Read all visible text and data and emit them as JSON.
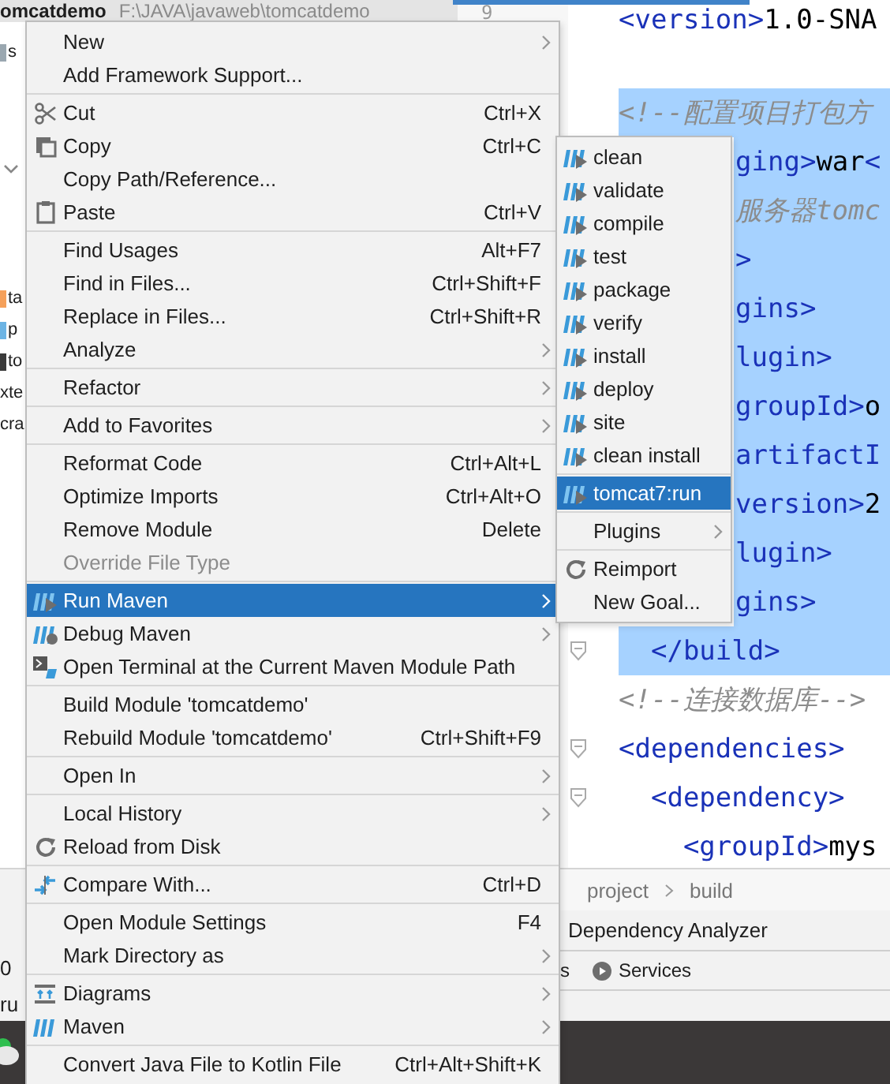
{
  "project_header": {
    "name": "omcatdemo",
    "path": "F:\\JAVA\\javaweb\\tomcatdemo"
  },
  "project_tree": [
    {
      "text": "s",
      "color": "#9aa7b0"
    },
    {
      "text": "ta",
      "color": "#f5a05a"
    },
    {
      "text": "p",
      "color": "#6cb4e4"
    },
    {
      "text": "to",
      "color": "#3a3a3a"
    },
    {
      "text": "xte"
    },
    {
      "text": "cra"
    }
  ],
  "editor": {
    "line_number": "9",
    "lines": [
      {
        "kind": "full",
        "selected": false,
        "parts": [
          {
            "kind": "tag",
            "t": "<version>"
          },
          {
            "kind": "text",
            "t": "1.0-SNA"
          }
        ]
      },
      {
        "kind": "blank"
      },
      {
        "kind": "full",
        "selected": true,
        "parts": [
          {
            "kind": "comment",
            "t": "<!--配置项目打包方"
          }
        ]
      },
      {
        "kind": "partial",
        "selected": true,
        "parts": [
          {
            "kind": "tag",
            "t": "ging>"
          },
          {
            "kind": "text",
            "t": "war"
          },
          {
            "kind": "tag",
            "t": "<"
          }
        ]
      },
      {
        "kind": "partial",
        "selected": true,
        "parts": [
          {
            "kind": "comment",
            "t": "服务器tomc"
          }
        ]
      },
      {
        "kind": "partial",
        "selected": true,
        "parts": [
          {
            "kind": "tag",
            "t": ">"
          }
        ]
      },
      {
        "kind": "partial",
        "selected": true,
        "parts": [
          {
            "kind": "tag",
            "t": "gins>"
          }
        ]
      },
      {
        "kind": "partial",
        "selected": true,
        "parts": [
          {
            "kind": "tag",
            "t": "lugin>"
          }
        ]
      },
      {
        "kind": "partial",
        "selected": true,
        "parts": [
          {
            "kind": "tag",
            "t": "groupId>"
          },
          {
            "kind": "text",
            "t": "o"
          }
        ]
      },
      {
        "kind": "partial",
        "selected": true,
        "parts": [
          {
            "kind": "tag",
            "t": "artifactI"
          }
        ]
      },
      {
        "kind": "partial",
        "selected": true,
        "parts": [
          {
            "kind": "tag",
            "t": "version>"
          },
          {
            "kind": "text",
            "t": "2"
          }
        ]
      },
      {
        "kind": "partial",
        "selected": true,
        "parts": [
          {
            "kind": "tag",
            "t": "lugin>"
          }
        ]
      },
      {
        "kind": "partial",
        "selected": true,
        "parts": [
          {
            "kind": "tag",
            "t": "gins>"
          }
        ]
      },
      {
        "kind": "full",
        "selected": true,
        "fold": true,
        "parts": [
          {
            "kind": "tag",
            "t": "  </build>"
          }
        ]
      },
      {
        "kind": "full",
        "selected": false,
        "parts": [
          {
            "kind": "comment",
            "t": "<!--连接数据库-->"
          }
        ]
      },
      {
        "kind": "full",
        "selected": false,
        "fold": true,
        "parts": [
          {
            "kind": "tag",
            "t": "<dependencies>"
          }
        ]
      },
      {
        "kind": "full",
        "selected": false,
        "fold": true,
        "parts": [
          {
            "kind": "tag",
            "t": "  <dependency>"
          }
        ]
      },
      {
        "kind": "full",
        "selected": false,
        "parts": [
          {
            "kind": "tag",
            "t": "    <groupId>"
          },
          {
            "kind": "text",
            "t": "mys"
          }
        ]
      }
    ]
  },
  "context_menu": [
    {
      "kind": "item",
      "label": "New",
      "submenu": true,
      "selected": false,
      "disabled": false
    },
    {
      "kind": "item",
      "label": "Add Framework Support...",
      "submenu": false,
      "selected": false,
      "disabled": false
    },
    {
      "kind": "separator"
    },
    {
      "kind": "item",
      "label": "Cut",
      "shortcut": "Ctrl+X",
      "submenu": false,
      "selected": false,
      "disabled": false
    },
    {
      "kind": "item",
      "label": "Copy",
      "shortcut": "Ctrl+C",
      "submenu": false,
      "selected": false,
      "disabled": false
    },
    {
      "kind": "item",
      "label": "Copy Path/Reference...",
      "submenu": false,
      "selected": false,
      "disabled": false
    },
    {
      "kind": "item",
      "label": "Paste",
      "shortcut": "Ctrl+V",
      "submenu": false,
      "selected": false,
      "disabled": false
    },
    {
      "kind": "separator"
    },
    {
      "kind": "item",
      "label": "Find Usages",
      "shortcut": "Alt+F7",
      "submenu": false,
      "selected": false,
      "disabled": false
    },
    {
      "kind": "item",
      "label": "Find in Files...",
      "shortcut": "Ctrl+Shift+F",
      "submenu": false,
      "selected": false,
      "disabled": false
    },
    {
      "kind": "item",
      "label": "Replace in Files...",
      "shortcut": "Ctrl+Shift+R",
      "submenu": false,
      "selected": false,
      "disabled": false
    },
    {
      "kind": "item",
      "label": "Analyze",
      "submenu": true,
      "selected": false,
      "disabled": false
    },
    {
      "kind": "separator"
    },
    {
      "kind": "item",
      "label": "Refactor",
      "submenu": true,
      "selected": false,
      "disabled": false
    },
    {
      "kind": "separator"
    },
    {
      "kind": "item",
      "label": "Add to Favorites",
      "submenu": true,
      "selected": false,
      "disabled": false
    },
    {
      "kind": "separator"
    },
    {
      "kind": "item",
      "label": "Reformat Code",
      "shortcut": "Ctrl+Alt+L",
      "submenu": false,
      "selected": false,
      "disabled": false
    },
    {
      "kind": "item",
      "label": "Optimize Imports",
      "shortcut": "Ctrl+Alt+O",
      "submenu": false,
      "selected": false,
      "disabled": false
    },
    {
      "kind": "item",
      "label": "Remove Module",
      "shortcut": "Delete",
      "submenu": false,
      "selected": false,
      "disabled": false
    },
    {
      "kind": "item",
      "label": "Override File Type",
      "submenu": false,
      "selected": false,
      "disabled": true
    },
    {
      "kind": "separator"
    },
    {
      "kind": "item",
      "label": "Run Maven",
      "submenu": true,
      "selected": true,
      "disabled": false
    },
    {
      "kind": "item",
      "label": "Debug Maven",
      "submenu": true,
      "selected": false,
      "disabled": false
    },
    {
      "kind": "item",
      "label": "Open Terminal at the Current Maven Module Path",
      "submenu": false,
      "selected": false,
      "disabled": false
    },
    {
      "kind": "separator"
    },
    {
      "kind": "item",
      "label": "Build Module 'tomcatdemo'",
      "submenu": false,
      "selected": false,
      "disabled": false
    },
    {
      "kind": "item",
      "label": "Rebuild Module 'tomcatdemo'",
      "shortcut": "Ctrl+Shift+F9",
      "submenu": false,
      "selected": false,
      "disabled": false
    },
    {
      "kind": "separator"
    },
    {
      "kind": "item",
      "label": "Open In",
      "submenu": true,
      "selected": false,
      "disabled": false
    },
    {
      "kind": "separator"
    },
    {
      "kind": "item",
      "label": "Local History",
      "submenu": true,
      "selected": false,
      "disabled": false
    },
    {
      "kind": "item",
      "label": "Reload from Disk",
      "submenu": false,
      "selected": false,
      "disabled": false
    },
    {
      "kind": "separator"
    },
    {
      "kind": "item",
      "label": "Compare With...",
      "shortcut": "Ctrl+D",
      "submenu": false,
      "selected": false,
      "disabled": false
    },
    {
      "kind": "separator"
    },
    {
      "kind": "item",
      "label": "Open Module Settings",
      "shortcut": "F4",
      "submenu": false,
      "selected": false,
      "disabled": false
    },
    {
      "kind": "item",
      "label": "Mark Directory as",
      "submenu": true,
      "selected": false,
      "disabled": false
    },
    {
      "kind": "separator"
    },
    {
      "kind": "item",
      "label": "Diagrams",
      "submenu": true,
      "selected": false,
      "disabled": false
    },
    {
      "kind": "item",
      "label": "Maven",
      "submenu": true,
      "selected": false,
      "disabled": false
    },
    {
      "kind": "separator"
    },
    {
      "kind": "item",
      "label": "Convert Java File to Kotlin File",
      "shortcut": "Ctrl+Alt+Shift+K",
      "submenu": false,
      "selected": false,
      "disabled": false
    }
  ],
  "maven_submenu": [
    {
      "kind": "item",
      "label": "clean",
      "submenu": false,
      "selected": false
    },
    {
      "kind": "item",
      "label": "validate",
      "submenu": false,
      "selected": false
    },
    {
      "kind": "item",
      "label": "compile",
      "submenu": false,
      "selected": false
    },
    {
      "kind": "item",
      "label": "test",
      "submenu": false,
      "selected": false
    },
    {
      "kind": "item",
      "label": "package",
      "submenu": false,
      "selected": false
    },
    {
      "kind": "item",
      "label": "verify",
      "submenu": false,
      "selected": false
    },
    {
      "kind": "item",
      "label": "install",
      "submenu": false,
      "selected": false
    },
    {
      "kind": "item",
      "label": "deploy",
      "submenu": false,
      "selected": false
    },
    {
      "kind": "item",
      "label": "site",
      "submenu": false,
      "selected": false
    },
    {
      "kind": "item",
      "label": "clean install",
      "submenu": false,
      "selected": false
    },
    {
      "kind": "separator"
    },
    {
      "kind": "item",
      "label": "tomcat7:run",
      "submenu": false,
      "selected": true
    },
    {
      "kind": "separator"
    },
    {
      "kind": "item",
      "label": "Plugins",
      "submenu": true,
      "selected": false
    },
    {
      "kind": "separator"
    },
    {
      "kind": "item",
      "label": "Reimport",
      "submenu": false,
      "selected": false
    },
    {
      "kind": "item",
      "label": "New Goal...",
      "submenu": false,
      "selected": false
    }
  ],
  "breadcrumb": [
    "project",
    "build"
  ],
  "tool_tabs": [
    "Dependency Analyzer"
  ],
  "tool_buttons": [
    {
      "kind": "plain",
      "label": "s"
    },
    {
      "kind": "with-icon",
      "label": "Services"
    }
  ],
  "status_fragments": [
    "0",
    "ru"
  ]
}
